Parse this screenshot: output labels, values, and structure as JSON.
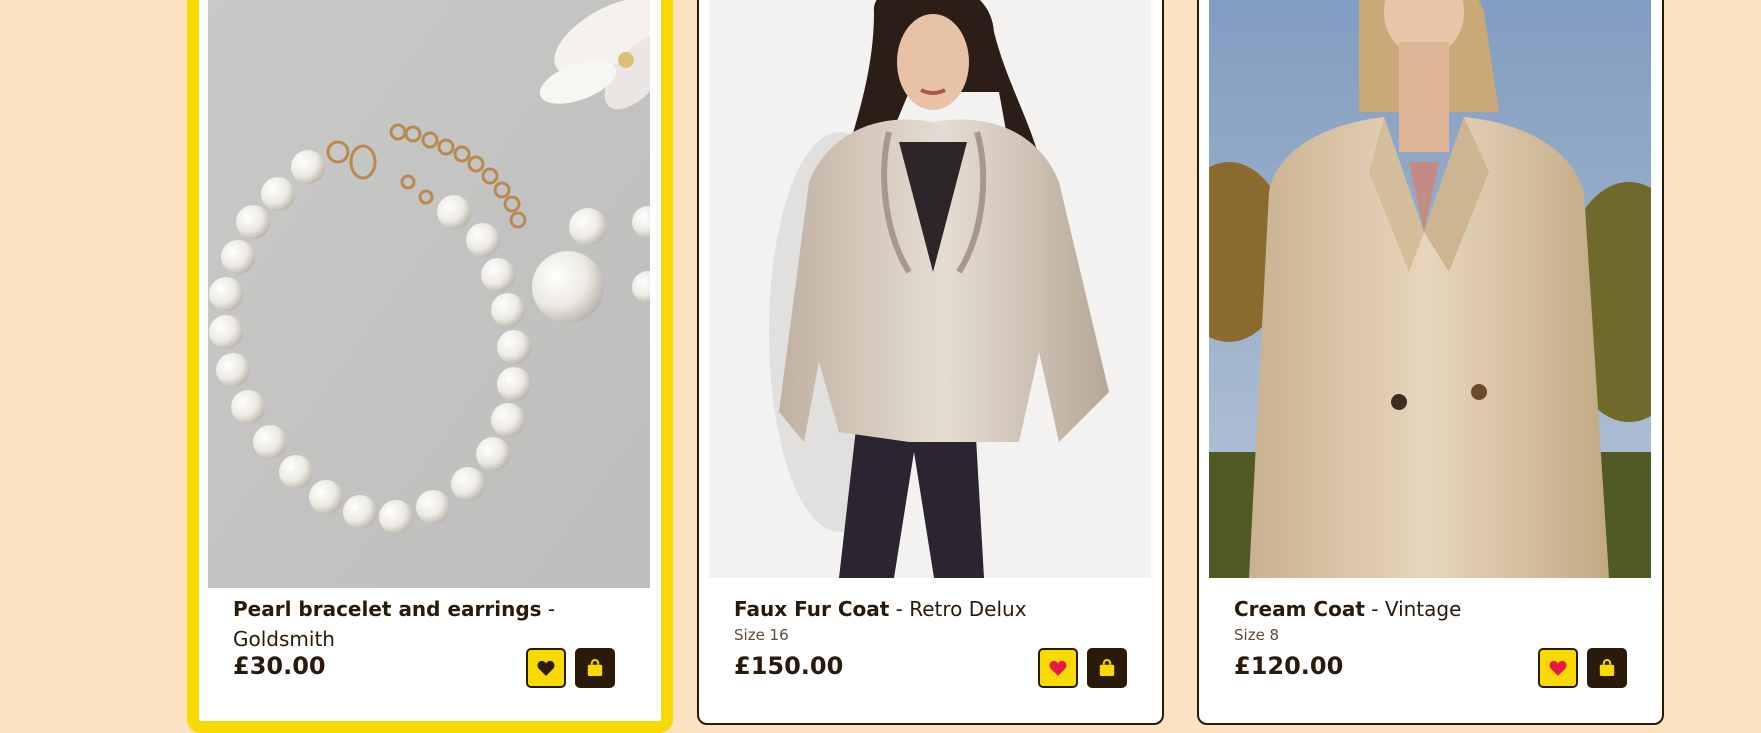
{
  "colors": {
    "background": "#fde3c1",
    "accent": "#f9da00",
    "dark": "#2a1a0c",
    "heart_red": "#e8194a"
  },
  "products": [
    {
      "name": "Pearl bracelet and earrings",
      "separator": "-",
      "brand": "Goldsmith",
      "size": "",
      "price": "£30.00",
      "image": "pearl-bracelet-photo",
      "selected": true,
      "favorite": false,
      "actions": {
        "favorite": "heart-icon",
        "cart": "shopping-bag-icon"
      }
    },
    {
      "name": "Faux Fur Coat",
      "separator": "-",
      "brand": "Retro Delux",
      "size": "Size 16",
      "price": "£150.00",
      "image": "fur-coat-model-photo",
      "selected": false,
      "favorite": true,
      "actions": {
        "favorite": "heart-icon",
        "cart": "shopping-bag-icon"
      }
    },
    {
      "name": "Cream Coat",
      "separator": "-",
      "brand": "Vintage",
      "size": "Size 8",
      "price": "£120.00",
      "image": "cream-coat-model-photo",
      "selected": false,
      "favorite": true,
      "actions": {
        "favorite": "heart-icon",
        "cart": "shopping-bag-icon"
      }
    }
  ]
}
